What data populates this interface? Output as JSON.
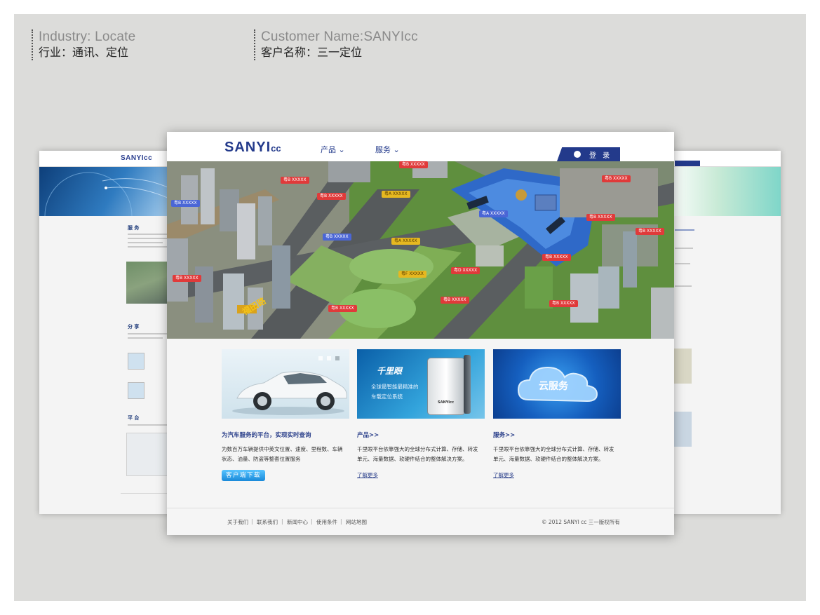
{
  "header": {
    "industry_en": "Industry: Locate",
    "industry_cn": "行业：通讯、定位",
    "customer_en": "Customer Name:SANYIcc",
    "customer_cn": "客户名称：三一定位"
  },
  "site": {
    "logo": "SANYI",
    "logo_suffix": "cc",
    "nav": [
      {
        "label": "产品",
        "caret": "⌄"
      },
      {
        "label": "服务",
        "caret": "⌄"
      }
    ],
    "login_label": "登 录"
  },
  "map_tags": [
    {
      "label": "粤B XXXXX",
      "color": "blue"
    },
    {
      "label": "粤B XXXXX",
      "color": "red"
    },
    {
      "label": "粤B XXXXX",
      "color": "red"
    },
    {
      "label": "粤B XXXXX",
      "color": "blue"
    },
    {
      "label": "粤A XXXXX",
      "color": "yel"
    },
    {
      "label": "粤B XXXXX",
      "color": "red"
    },
    {
      "label": "粤A XXXXX",
      "color": "blue"
    },
    {
      "label": "粤A XXXXX",
      "color": "yel"
    },
    {
      "label": "粤B XXXXX",
      "color": "red"
    },
    {
      "label": "粤F XXXXX",
      "color": "yel"
    },
    {
      "label": "粤D XXXXX",
      "color": "red"
    },
    {
      "label": "粤B XXXXX",
      "color": "red"
    },
    {
      "label": "粤B XXXXX",
      "color": "red"
    },
    {
      "label": "粤B XXXXX",
      "color": "red"
    },
    {
      "label": "粤B XXXXX",
      "color": "red"
    },
    {
      "label": "粤B XXXXX",
      "color": "red"
    },
    {
      "label": "粤B XXXXX",
      "color": "red"
    },
    {
      "label": "粤B XXXXX",
      "color": "red"
    }
  ],
  "map_sign": "福田路",
  "cards": [
    {
      "title": "为汽车服务的平台，实现实时查询",
      "text": "为数百万车辆提供中英文位置、速度、里程数、车辆状态、油量、防盗等整套位置服务",
      "button": "客户端下载"
    },
    {
      "title": "产品>>",
      "text": "千里眼平台依靠强大的全球分布式计算、存储、转发单元、海量数据、软硬件结合的整体解决方案。",
      "more": "了解更多",
      "image_text_1": "千里眼",
      "image_text_2": "全球最智能最精准的",
      "image_text_3": "车载定位系统",
      "device_label": "SANYIcc"
    },
    {
      "title": "服务>>",
      "text": "千里眼平台依靠强大的全球分布式计算、存储、转发单元、海量数据、软硬件结合的整体解决方案。",
      "more": "了解更多",
      "image_text": "云服务"
    }
  ],
  "footer": {
    "links": [
      "关于我们",
      "联系我们",
      "新闻中心",
      "使用条件",
      "网站地图"
    ],
    "copyright": "© 2012 SANYI cc    三一版权所有"
  },
  "back_left": {
    "logo": "SANYIcc",
    "sections": [
      "服 务",
      "分 享",
      "平 台"
    ]
  }
}
